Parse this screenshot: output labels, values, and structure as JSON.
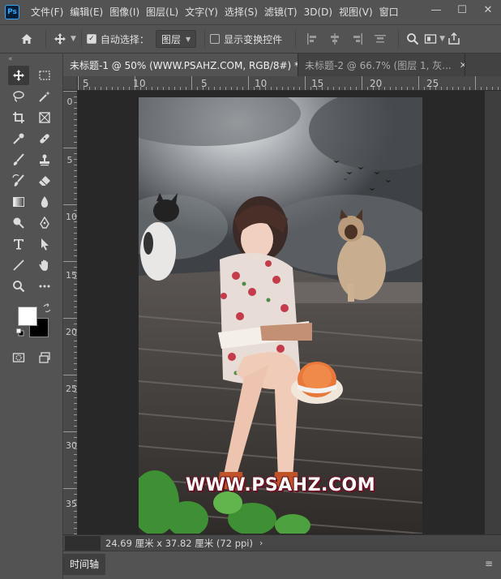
{
  "app": {
    "logo": "Ps"
  },
  "menu": [
    "文件(F)",
    "编辑(E)",
    "图像(I)",
    "图层(L)",
    "文字(Y)",
    "选择(S)",
    "滤镜(T)",
    "3D(D)",
    "视图(V)",
    "窗口"
  ],
  "window_controls": {
    "minimize": "—",
    "maximize": "☐",
    "close": "✕"
  },
  "options": {
    "auto_select_label": "自动选择：",
    "auto_select_checked": true,
    "auto_select_target": "图层",
    "show_transform_label": "显示变换控件",
    "show_transform_checked": false
  },
  "toolbar": {
    "collapse": "«",
    "foreground_color": "#ffffff",
    "background_color": "#000000"
  },
  "tabs": [
    {
      "label": "未标题-1 @ 50% (WWW.PSAHZ.COM, RGB/8#) *",
      "close": "✕",
      "active": true
    },
    {
      "label": "未标题-2 @ 66.7% (图层 1, 灰...",
      "close": "✕",
      "active": false
    }
  ],
  "ruler": {
    "horizontal": [
      "5",
      "1",
      "0",
      "5",
      "10",
      "15",
      "20",
      "25"
    ],
    "vertical": [
      "0",
      "5",
      "10",
      "15",
      "20",
      "25",
      "30",
      "35"
    ]
  },
  "canvas": {
    "watermark": "WWW.PSAHZ.COM"
  },
  "status": {
    "doc_size": "24.69 厘米 x 37.82 厘米 (72 ppi)",
    "arrow": "›"
  },
  "timeline": {
    "tab_label": "时间轴",
    "menu_icon": "≡"
  }
}
